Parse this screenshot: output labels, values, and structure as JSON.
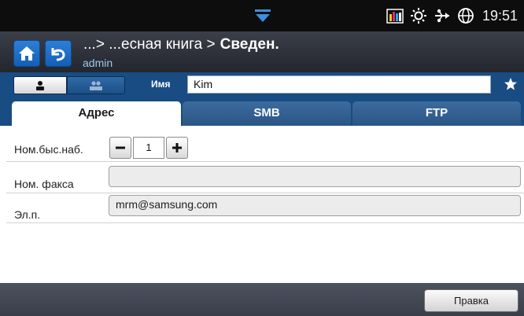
{
  "status_bar": {
    "time": "19:51",
    "icons": [
      "pull-down-handle-icon",
      "toner-levels-icon",
      "brightness-icon",
      "network-icon",
      "globe-icon"
    ]
  },
  "title_bar": {
    "path": "...> ...есная книга >",
    "current": "Сведен.",
    "user": "admin"
  },
  "name_row": {
    "label": "Имя",
    "value": "Kim"
  },
  "tabs": [
    {
      "label": "Адрес",
      "active": true
    },
    {
      "label": "SMB",
      "active": false
    },
    {
      "label": "FTP",
      "active": false
    }
  ],
  "form": {
    "speed_dial": {
      "label": "Ном.быс.наб.",
      "value": "1"
    },
    "fax": {
      "label": "Ном. факса",
      "value": ""
    },
    "email": {
      "label": "Эл.п.",
      "value": "mrm@samsung.com"
    }
  },
  "bottom_bar": {
    "edit_label": "Правка"
  },
  "colors": {
    "accent_blue": "#184c83",
    "title_bar": "#2c3038",
    "home_button": "#1f6fc8"
  }
}
